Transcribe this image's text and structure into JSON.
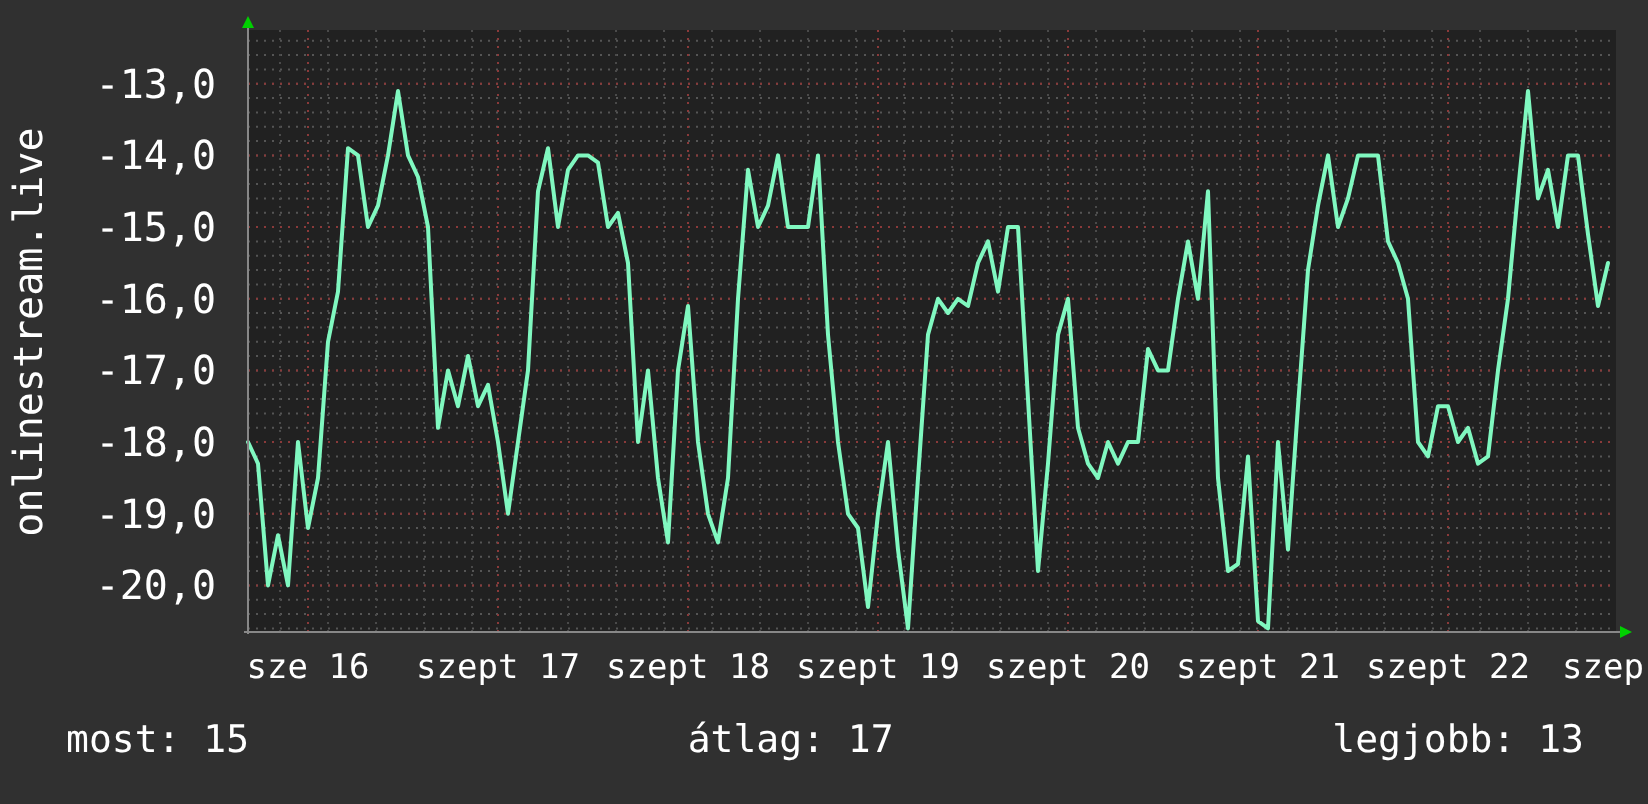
{
  "chart": {
    "chart_data": {
      "type": "line",
      "grid": true,
      "ylabel": "onlinestream.live",
      "ylim": [
        -20.65,
        -12.25
      ],
      "yticks": [
        {
          "value": -13,
          "label": "-13,0"
        },
        {
          "value": -14,
          "label": "-14,0"
        },
        {
          "value": -15,
          "label": "-15,0"
        },
        {
          "value": -16,
          "label": "-16,0"
        },
        {
          "value": -17,
          "label": "-17,0"
        },
        {
          "value": -18,
          "label": "-18,0"
        },
        {
          "value": -19,
          "label": "-19,0"
        },
        {
          "value": -20,
          "label": "-20,0"
        }
      ],
      "categories": [
        null,
        null,
        null,
        null,
        null,
        null,
        "sze 16",
        null,
        null,
        null,
        null,
        null,
        null,
        null,
        null,
        null,
        null,
        null,
        null,
        null,
        null,
        null,
        null,
        null,
        null,
        "szept 17",
        null,
        null,
        null,
        null,
        null,
        null,
        null,
        null,
        null,
        null,
        null,
        null,
        null,
        null,
        null,
        null,
        null,
        null,
        "szept 18",
        null,
        null,
        null,
        null,
        null,
        null,
        null,
        null,
        null,
        null,
        null,
        null,
        null,
        null,
        null,
        null,
        null,
        null,
        "szept 19",
        null,
        null,
        null,
        null,
        null,
        null,
        null,
        null,
        null,
        null,
        null,
        null,
        null,
        null,
        null,
        null,
        null,
        null,
        "szept 20",
        null,
        null,
        null,
        null,
        null,
        null,
        null,
        null,
        null,
        null,
        null,
        null,
        null,
        null,
        null,
        null,
        null,
        null,
        "szept 21",
        null,
        null,
        null,
        null,
        null,
        null,
        null,
        null,
        null,
        null,
        null,
        null,
        null,
        null,
        null,
        null,
        null,
        null,
        "szept 22",
        null,
        null,
        null,
        null,
        null,
        null,
        null,
        null,
        null,
        null,
        null,
        null,
        null,
        null,
        null,
        "szep"
      ],
      "series": [
        {
          "color": "#80f8c0",
          "values": [
            -18,
            -18.3,
            -20,
            -19.3,
            -20,
            -18,
            -19.2,
            -18.5,
            -16.6,
            -15.9,
            -13.9,
            -14,
            -15,
            -14.7,
            -14,
            -13.1,
            -14,
            -14.3,
            -15,
            -17.8,
            -17,
            -17.5,
            -16.8,
            -17.5,
            -17.2,
            -18,
            -19,
            -18,
            -17,
            -14.5,
            -13.9,
            -15,
            -14.2,
            -14,
            -14,
            -14.1,
            -15,
            -14.8,
            -15.5,
            -18,
            -17,
            -18.5,
            -19.4,
            -17,
            -16.1,
            -18,
            -19,
            -19.4,
            -18.5,
            -16,
            -14.2,
            -15,
            -14.7,
            -14,
            -15,
            -15,
            -15,
            -14,
            -16.5,
            -18,
            -19,
            -19.2,
            -20.3,
            -19,
            -18,
            -19.5,
            -20.6,
            -18.5,
            -16.5,
            -16,
            -16.2,
            -16,
            -16.1,
            -15.5,
            -15.2,
            -15.9,
            -15,
            -15,
            -17.4,
            -19.8,
            -18.3,
            -16.5,
            -16,
            -17.8,
            -18.3,
            -18.5,
            -18,
            -18.3,
            -18,
            -18,
            -16.7,
            -17,
            -17,
            -16,
            -15.2,
            -16,
            -14.5,
            -18.5,
            -19.8,
            -19.7,
            -18.2,
            -20.5,
            -20.6,
            -18,
            -19.5,
            -17.5,
            -15.6,
            -14.7,
            -14,
            -15,
            -14.6,
            -14,
            -14,
            -14,
            -15.2,
            -15.5,
            -16,
            -18,
            -18.2,
            -17.5,
            -17.5,
            -18,
            -17.8,
            -18.3,
            -18.2,
            -17,
            -16,
            -14.5,
            -13.1,
            -14.6,
            -14.2,
            -15,
            -14,
            -14,
            -15.1,
            -16.1,
            -15.5
          ]
        }
      ]
    }
  },
  "stats": [
    "most: 15",
    "átlag: 17",
    "legjobb: 13"
  ]
}
